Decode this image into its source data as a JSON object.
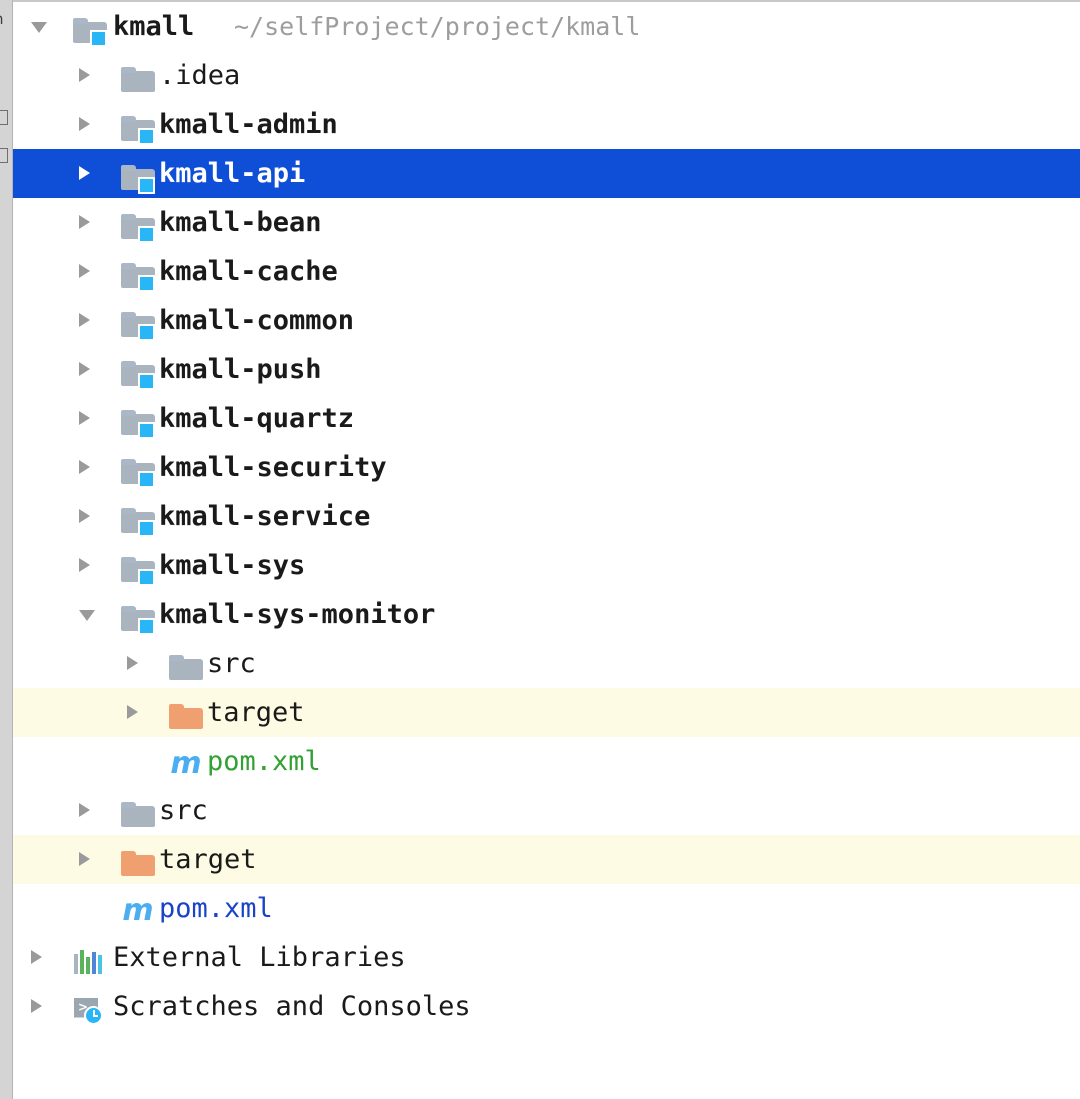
{
  "window": {
    "kind": "ide-project-tool-window",
    "accent_selection": "#0f4fd8",
    "excluded_row_bg": "#fdfbe3",
    "module_badge_color": "#29b6f6",
    "folder_color": "#a9b4bf",
    "target_folder_color": "#f0a070"
  },
  "toolstrip": {
    "glyph_top": "n",
    "items": [
      "partial-icon-1",
      "partial-icon-2"
    ]
  },
  "tree": {
    "rows": [
      {
        "label": "kmall",
        "path": "~/selfProject/project/kmall",
        "depth": 0,
        "icon": "module-folder-icon",
        "arrow": "expanded",
        "bold": true,
        "selected": false,
        "excluded": false,
        "label_color": "default"
      },
      {
        "label": ".idea",
        "path": "",
        "depth": 1,
        "icon": "folder-icon",
        "arrow": "collapsed",
        "bold": false,
        "selected": false,
        "excluded": false,
        "label_color": "default"
      },
      {
        "label": "kmall-admin",
        "path": "",
        "depth": 1,
        "icon": "module-folder-icon",
        "arrow": "collapsed",
        "bold": true,
        "selected": false,
        "excluded": false,
        "label_color": "default"
      },
      {
        "label": "kmall-api",
        "path": "",
        "depth": 1,
        "icon": "module-folder-icon",
        "arrow": "collapsed",
        "bold": true,
        "selected": true,
        "excluded": false,
        "label_color": "default"
      },
      {
        "label": "kmall-bean",
        "path": "",
        "depth": 1,
        "icon": "module-folder-icon",
        "arrow": "collapsed",
        "bold": true,
        "selected": false,
        "excluded": false,
        "label_color": "default"
      },
      {
        "label": "kmall-cache",
        "path": "",
        "depth": 1,
        "icon": "module-folder-icon",
        "arrow": "collapsed",
        "bold": true,
        "selected": false,
        "excluded": false,
        "label_color": "default"
      },
      {
        "label": "kmall-common",
        "path": "",
        "depth": 1,
        "icon": "module-folder-icon",
        "arrow": "collapsed",
        "bold": true,
        "selected": false,
        "excluded": false,
        "label_color": "default"
      },
      {
        "label": "kmall-push",
        "path": "",
        "depth": 1,
        "icon": "module-folder-icon",
        "arrow": "collapsed",
        "bold": true,
        "selected": false,
        "excluded": false,
        "label_color": "default"
      },
      {
        "label": "kmall-quartz",
        "path": "",
        "depth": 1,
        "icon": "module-folder-icon",
        "arrow": "collapsed",
        "bold": true,
        "selected": false,
        "excluded": false,
        "label_color": "default"
      },
      {
        "label": "kmall-security",
        "path": "",
        "depth": 1,
        "icon": "module-folder-icon",
        "arrow": "collapsed",
        "bold": true,
        "selected": false,
        "excluded": false,
        "label_color": "default"
      },
      {
        "label": "kmall-service",
        "path": "",
        "depth": 1,
        "icon": "module-folder-icon",
        "arrow": "collapsed",
        "bold": true,
        "selected": false,
        "excluded": false,
        "label_color": "default"
      },
      {
        "label": "kmall-sys",
        "path": "",
        "depth": 1,
        "icon": "module-folder-icon",
        "arrow": "collapsed",
        "bold": true,
        "selected": false,
        "excluded": false,
        "label_color": "default"
      },
      {
        "label": "kmall-sys-monitor",
        "path": "",
        "depth": 1,
        "icon": "module-folder-icon",
        "arrow": "expanded",
        "bold": true,
        "selected": false,
        "excluded": false,
        "label_color": "default"
      },
      {
        "label": "src",
        "path": "",
        "depth": 2,
        "icon": "folder-icon",
        "arrow": "collapsed",
        "bold": false,
        "selected": false,
        "excluded": false,
        "label_color": "default"
      },
      {
        "label": "target",
        "path": "",
        "depth": 2,
        "icon": "target-folder-icon",
        "arrow": "collapsed",
        "bold": false,
        "selected": false,
        "excluded": true,
        "label_color": "default"
      },
      {
        "label": "pom.xml",
        "path": "",
        "depth": 2,
        "icon": "maven-file-icon",
        "arrow": "none",
        "bold": false,
        "selected": false,
        "excluded": false,
        "label_color": "green"
      },
      {
        "label": "src",
        "path": "",
        "depth": 1,
        "icon": "folder-icon",
        "arrow": "collapsed",
        "bold": false,
        "selected": false,
        "excluded": false,
        "label_color": "default"
      },
      {
        "label": "target",
        "path": "",
        "depth": 1,
        "icon": "target-folder-icon",
        "arrow": "collapsed",
        "bold": false,
        "selected": false,
        "excluded": true,
        "label_color": "default"
      },
      {
        "label": "pom.xml",
        "path": "",
        "depth": 1,
        "icon": "maven-file-icon",
        "arrow": "none",
        "bold": false,
        "selected": false,
        "excluded": false,
        "label_color": "blue"
      },
      {
        "label": "External Libraries",
        "path": "",
        "depth": 0,
        "icon": "external-libraries-icon",
        "arrow": "collapsed",
        "bold": false,
        "selected": false,
        "excluded": false,
        "label_color": "default"
      },
      {
        "label": "Scratches and Consoles",
        "path": "",
        "depth": 0,
        "icon": "scratches-icon",
        "arrow": "collapsed",
        "bold": false,
        "selected": false,
        "excluded": false,
        "label_color": "default"
      }
    ]
  }
}
